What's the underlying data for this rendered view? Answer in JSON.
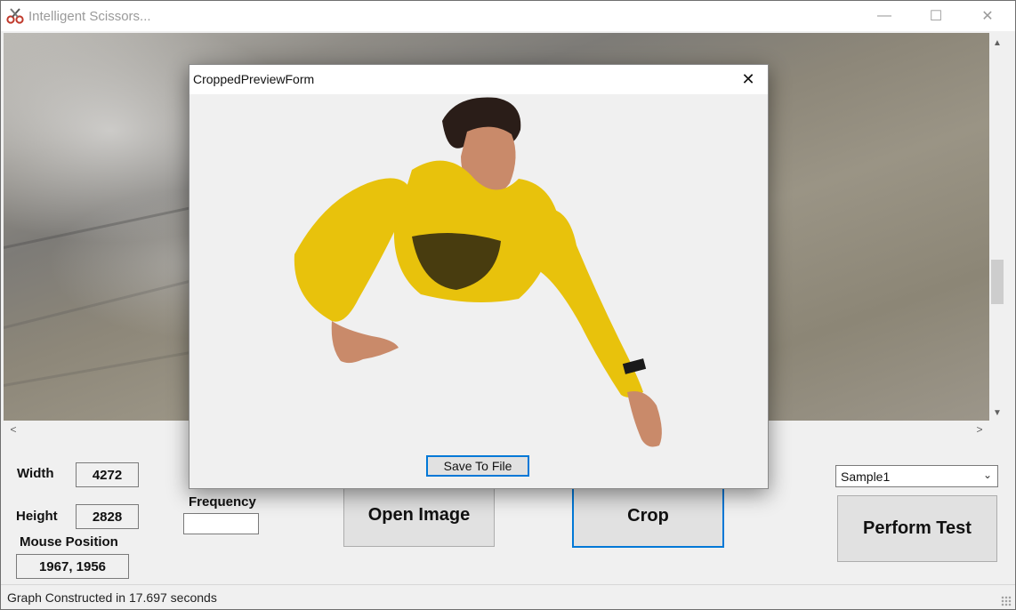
{
  "window": {
    "title": "Intelligent Scissors...",
    "controls": {
      "minimize": "—",
      "maximize": "☐",
      "close": "✕"
    }
  },
  "icons": {
    "app": "scissors-icon",
    "scroll_up": "▲",
    "scroll_down": "▼",
    "scroll_left": "<",
    "scroll_right": ">",
    "dropdown": "⌄"
  },
  "image_info": {
    "width_label": "Width",
    "width_value": "4272",
    "height_label": "Height",
    "height_value": "2828",
    "mouse_label": "Mouse Position",
    "mouse_value": "1967, 1956"
  },
  "frequency": {
    "label": "Frequency",
    "value": ""
  },
  "buttons": {
    "open_image": "Open Image",
    "crop": "Crop",
    "perform_test": "Perform Test"
  },
  "sample_select": {
    "selected": "Sample1"
  },
  "status": {
    "text": "Graph Constructed in 17.697 seconds"
  },
  "dialog": {
    "title": "CroppedPreviewForm",
    "close": "✕",
    "save_button": "Save To File"
  },
  "colors": {
    "accent": "#0078d7",
    "shirt_yellow": "#e8c20c",
    "skin": "#c98a6a",
    "hair": "#2a1d18"
  }
}
